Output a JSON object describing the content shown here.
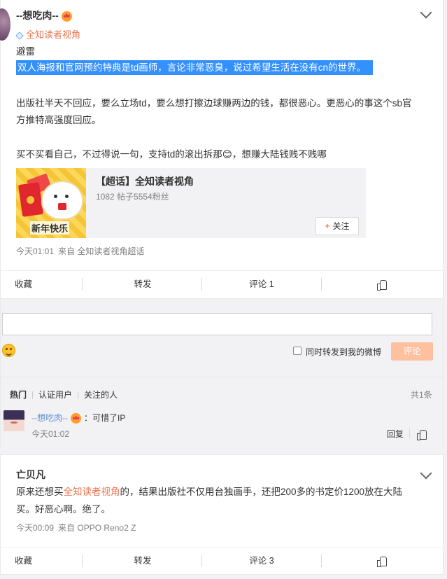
{
  "post1": {
    "username": "--想吃肉--",
    "topic": "全知读者视角",
    "lines": [
      "避雷",
      "双人海报和官网预约特典是td画师，言论非常恶臭，说过希望生活在没有cn的世界。",
      "出版社半天不回应，要么立场td，要么想打擦边球赚两边的钱，都很恶心。更恶心的事这个sb官",
      "方推特高强度回应。",
      "买不买看自己，不过得说一句，支持td的滚出拆那😊，想赚大陆钱贱不贱哪"
    ],
    "share": {
      "thumb_caption": "新年快乐",
      "title": "【超话】全知读者视角",
      "subtitle": "1082 帖子5554粉丝",
      "follow_label": "关注"
    },
    "time": "今天01:01",
    "source": "来自 全知读者视角超话",
    "actions": {
      "collect": "收藏",
      "repost": "转发",
      "comment": "评论 1"
    }
  },
  "comment_panel": {
    "input_placeholder": "",
    "forward_label": "同时转发到我的微博",
    "submit_label": "评论",
    "tabs": [
      "热门",
      "认证用户",
      "关注的人"
    ],
    "total": "共1条",
    "comments": [
      {
        "user": "--想吃肉--",
        "text": "：可惜了IP",
        "time": "今天01:02",
        "reply_label": "回复"
      }
    ]
  },
  "post2": {
    "username": "亡贝凡",
    "line1_before": "原来还想买",
    "line1_link": "全知读者视角",
    "line1_after": "的，结果出版社不仅用台独画手，还把200多的书定价1200放在大陆",
    "line2": "买。好恶心啊。绝了。",
    "time": "今天00:09",
    "source": "来自 OPPO Reno2 Z",
    "actions": {
      "collect": "收藏",
      "repost": "转发",
      "comment": "评论 3"
    }
  },
  "colors": {
    "accent_orange": "#eb7350",
    "highlight_blue": "#3390ff",
    "link_blue": "#5d8fd3",
    "submit_disabled": "#ffc09f"
  }
}
